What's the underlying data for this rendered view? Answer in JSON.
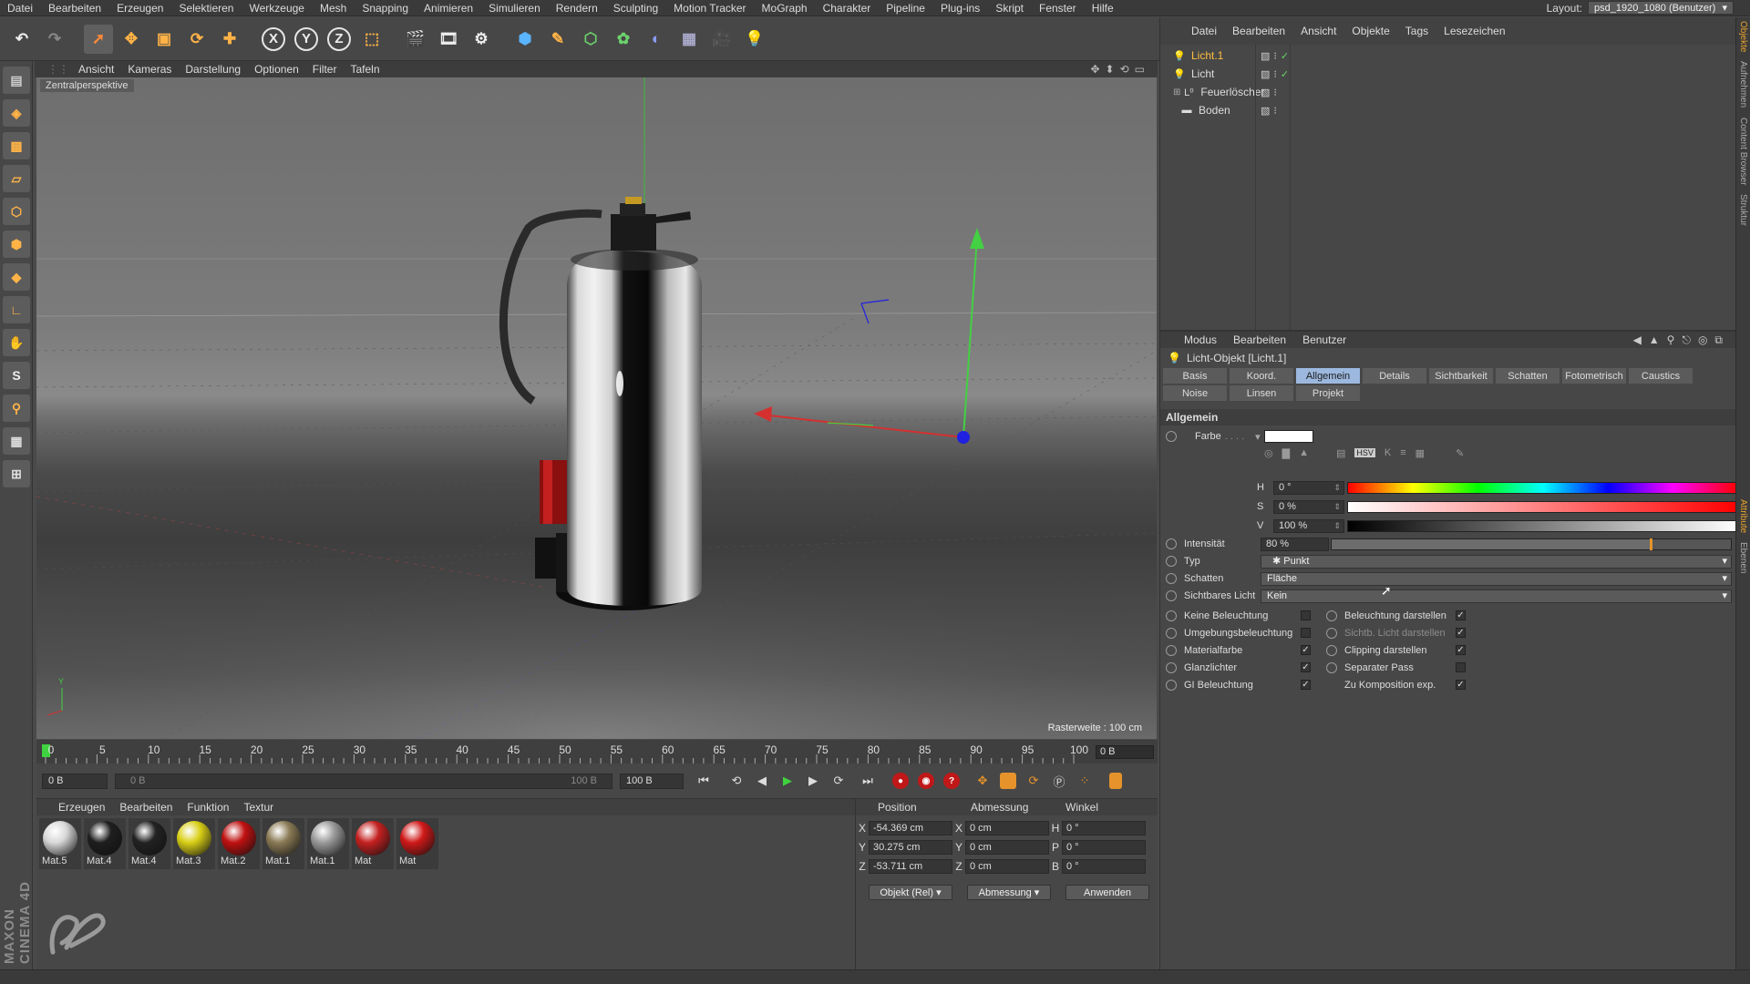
{
  "menubar": {
    "items": [
      "Datei",
      "Bearbeiten",
      "Erzeugen",
      "Selektieren",
      "Werkzeuge",
      "Mesh",
      "Snapping",
      "Animieren",
      "Simulieren",
      "Rendern",
      "Sculpting",
      "Motion Tracker",
      "MoGraph",
      "Charakter",
      "Pipeline",
      "Plug-ins",
      "Skript",
      "Fenster",
      "Hilfe"
    ],
    "layout_label": "Layout:",
    "layout_value": "psd_1920_1080 (Benutzer)"
  },
  "toolbar": {
    "axis_x": "X",
    "axis_y": "Y",
    "axis_z": "Z"
  },
  "viewport": {
    "menu": [
      "Ansicht",
      "Kameras",
      "Darstellung",
      "Optionen",
      "Filter",
      "Tafeln"
    ],
    "camera_label": "Zentralperspektive",
    "grid_text": "Rasterweite : 100 cm"
  },
  "timeline": {
    "ticks": [
      "0",
      "5",
      "10",
      "15",
      "20",
      "25",
      "30",
      "35",
      "40",
      "45",
      "50",
      "55",
      "60",
      "65",
      "70",
      "75",
      "80",
      "85",
      "90",
      "95",
      "100"
    ],
    "current_frame": "0 B"
  },
  "transport": {
    "start": "0 B",
    "range_start": "0 B",
    "range_end": "100 B",
    "end": "100 B"
  },
  "materials": {
    "menu": [
      "Erzeugen",
      "Bearbeiten",
      "Funktion",
      "Textur"
    ],
    "items": [
      {
        "label": "Mat.5",
        "color": "#d8d8d8"
      },
      {
        "label": "Mat.4",
        "color": "#1e1e1e"
      },
      {
        "label": "Mat.4",
        "color": "#222222"
      },
      {
        "label": "Mat.3",
        "color": "#d9cf16"
      },
      {
        "label": "Mat.2",
        "color": "#c01010"
      },
      {
        "label": "Mat.1",
        "color": "#8a7a55"
      },
      {
        "label": "Mat.1",
        "color": "#9a9a9a"
      },
      {
        "label": "Mat",
        "color": "#c42020"
      },
      {
        "label": "Mat",
        "color": "#d01818"
      }
    ],
    "brand_vertical": "MAXON CINEMA 4D"
  },
  "coordinates": {
    "headers": [
      "Position",
      "Abmessung",
      "Winkel"
    ],
    "rows": [
      {
        "axis": "X",
        "pos": "-54.369 cm",
        "size_axis": "X",
        "size": "0 cm",
        "rot_axis": "H",
        "rot": "0 °"
      },
      {
        "axis": "Y",
        "pos": "30.275 cm",
        "size_axis": "Y",
        "size": "0 cm",
        "rot_axis": "P",
        "rot": "0 °"
      },
      {
        "axis": "Z",
        "pos": "-53.711 cm",
        "size_axis": "Z",
        "size": "0 cm",
        "rot_axis": "B",
        "rot": "0 °"
      }
    ],
    "mode": "Objekt (Rel)",
    "size_mode": "Abmessung",
    "apply": "Anwenden"
  },
  "objects": {
    "menu": [
      "Datei",
      "Bearbeiten",
      "Ansicht",
      "Objekte",
      "Tags",
      "Lesezeichen"
    ],
    "items": [
      {
        "name": "Licht.1",
        "active": true
      },
      {
        "name": "Licht",
        "active": false
      },
      {
        "name": "Feuerlöscher",
        "active": false
      },
      {
        "name": "Boden",
        "active": false
      }
    ]
  },
  "attributes": {
    "menu": [
      "Modus",
      "Bearbeiten",
      "Benutzer"
    ],
    "title": "Licht-Objekt [Licht.1]",
    "tabs_row1": [
      "Basis",
      "Koord.",
      "Allgemein",
      "Details",
      "Sichtbarkeit",
      "Schatten",
      "Fotometrisch",
      "Caustics"
    ],
    "tabs_row2": [
      "Noise",
      "Linsen",
      "Projekt"
    ],
    "active_tab": "Allgemein",
    "section": "Allgemein",
    "farbe_label": "Farbe",
    "h_label": "H",
    "h_value": "0 °",
    "s_label": "S",
    "s_value": "0 %",
    "v_label": "V",
    "v_value": "100 %",
    "intensity_label": "Intensität",
    "intensity_value": "80 %",
    "intensity_level": 0.8,
    "typ_label": "Typ",
    "typ_value": "Punkt",
    "schatten_label": "Schatten",
    "schatten_value": "Fläche",
    "sicht_label": "Sichtbares Licht",
    "sicht_value": "Kein",
    "left_checks": [
      {
        "label": "Keine Beleuchtung",
        "checked": false
      },
      {
        "label": "Umgebungsbeleuchtung",
        "checked": false
      },
      {
        "label": "Materialfarbe",
        "checked": true
      },
      {
        "label": "Glanzlichter",
        "checked": true
      },
      {
        "label": "GI Beleuchtung",
        "checked": true
      }
    ],
    "right_checks": [
      {
        "label": "Beleuchtung darstellen",
        "checked": true
      },
      {
        "label": "Sichtb. Licht darstellen",
        "checked": true
      },
      {
        "label": "Clipping darstellen",
        "checked": true
      },
      {
        "label": "Separater Pass",
        "checked": false
      },
      {
        "label": "Zu Komposition exp.",
        "checked": true
      }
    ],
    "color_mode_hsv": "HSV"
  },
  "right_tabs": [
    "Objekte",
    "Aufnehmen",
    "Content Browser",
    "Struktur",
    "Attribute",
    "Ebenen"
  ],
  "colors": {
    "accent_tab": "#9cb8de",
    "active_object": "#ffbf3f",
    "intensity_marker": "#e5932a"
  }
}
